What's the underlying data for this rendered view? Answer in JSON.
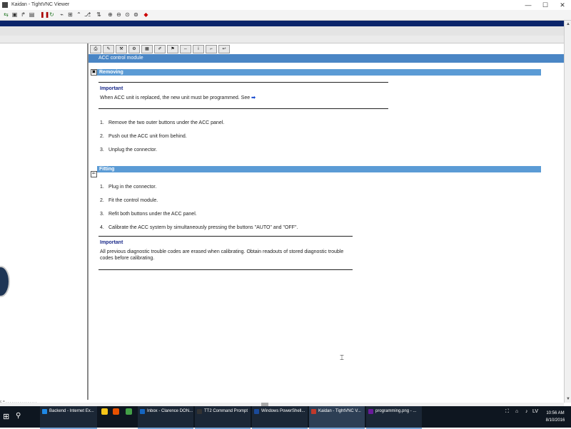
{
  "window": {
    "title": "Kaidan - TightVNC Viewer",
    "controls": {
      "minimize": "—",
      "maximize": "☐",
      "close": "✕"
    }
  },
  "document": {
    "header": "ACC control module",
    "section_removing": "Removing",
    "important_label": "Important",
    "important1_text": "When ACC unit is replaced, the new unit must be programmed. See",
    "removing_steps": [
      {
        "n": "1.",
        "text": "Remove the two outer buttons under the ACC panel."
      },
      {
        "n": "2.",
        "text": "Push out the ACC unit from behind."
      },
      {
        "n": "3.",
        "text": "Unplug the connector."
      }
    ],
    "section_fitting": "Fitting",
    "fitting_steps": [
      {
        "n": "1.",
        "text": "Plug in the connector."
      },
      {
        "n": "2.",
        "text": "Fit the control module."
      },
      {
        "n": "3.",
        "text": "Refit both buttons under the ACC panel."
      },
      {
        "n": "4.",
        "text": "Calibrate the ACC system by simultaneously pressing the buttons \"AUTO\" and \"OFF\"."
      }
    ],
    "important2_text": "All previous diagnostic trouble codes are erased when calibrating. Obtain readouts of stored diagnostic trouble codes before calibrating."
  },
  "left_status": "c = . . . . . . . . . . . . . . . .",
  "taskbar": {
    "items": [
      {
        "label": "Backend - Internet Ex...",
        "color": "#1e88e5"
      },
      {
        "label": "Inbox - Clarence DON...",
        "color": "#1565c0"
      },
      {
        "label": "TT2 Command Prompt",
        "color": "#333333"
      },
      {
        "label": "Windows PowerShell...",
        "color": "#1a4a9a"
      },
      {
        "label": "Kaidan - TightVNC V...",
        "color": "#c0392b"
      },
      {
        "label": "programming.png - ...",
        "color": "#6a1b9a"
      }
    ],
    "tray_lang": "LV",
    "time": "10:56 AM",
    "date": "8/10/2016"
  },
  "colors": {
    "header_blue": "#4a86c5",
    "section_blue": "#5b9bd5",
    "remote_titlebar": "#0a246a",
    "taskbar": "#0e1620"
  }
}
